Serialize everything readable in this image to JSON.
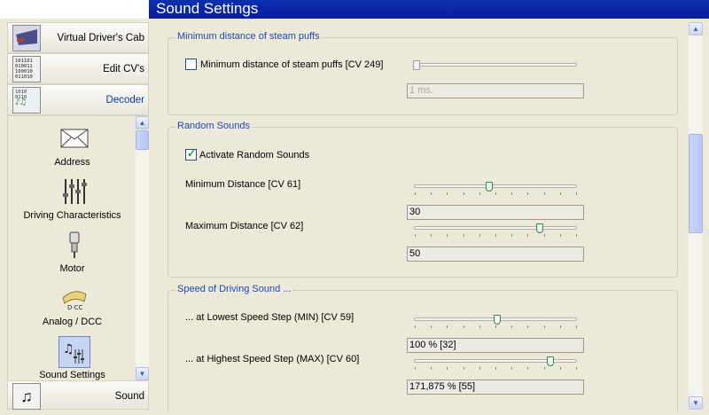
{
  "window": {
    "title": "Sound Settings"
  },
  "nav": {
    "items": [
      {
        "label": "Virtual Driver's Cab",
        "icon": "cab-icon"
      },
      {
        "label": "Edit CV's",
        "icon": "binary-icon"
      },
      {
        "label": "Decoder",
        "icon": "decoder-icon",
        "active": true
      }
    ],
    "bottom": {
      "label": "Sound",
      "icon": "music-notes-icon"
    }
  },
  "decoder_menu": {
    "items": [
      {
        "label": "Address",
        "icon": "envelope-icon",
        "glyph": "✉"
      },
      {
        "label": "Driving Characteristics",
        "icon": "sliders-icon",
        "glyph": "╫"
      },
      {
        "label": "Motor",
        "icon": "motor-icon",
        "glyph": "⚙"
      },
      {
        "label": "Analog / DCC",
        "icon": "gauge-icon",
        "glyph": "◠"
      },
      {
        "label": "Sound Settings",
        "icon": "sound-settings-icon",
        "glyph": "♫",
        "selected": true
      }
    ]
  },
  "steam_puffs": {
    "title": "Minimum distance of steam puffs",
    "checkbox_label": "Minimum distance of steam puffs [CV 249]",
    "checked": false,
    "slider_level": 0.0,
    "value": "1 ms."
  },
  "random_sounds": {
    "title": "Random Sounds",
    "checkbox_label": "Activate Random Sounds",
    "checked": true,
    "min_label": "Minimum Distance [CV 61]",
    "min_level": 0.46,
    "min_value": "30",
    "max_label": "Maximum Distance [CV 62]",
    "max_level": 0.78,
    "max_value": "50"
  },
  "speed_sound": {
    "title": "Speed of Driving Sound ...",
    "low_label": "... at Lowest Speed Step (MIN) [CV 59]",
    "low_level": 0.51,
    "low_value": "100 %  [32]",
    "high_label": "... at Highest Speed Step (MAX) [CV 60]",
    "high_level": 0.85,
    "high_value": "171,875 %  [55]"
  },
  "colors": {
    "title_bar": "#0a1f9a",
    "group_title": "#1e46b4",
    "check_mark": "#21a121",
    "background": "#ece9d8"
  }
}
